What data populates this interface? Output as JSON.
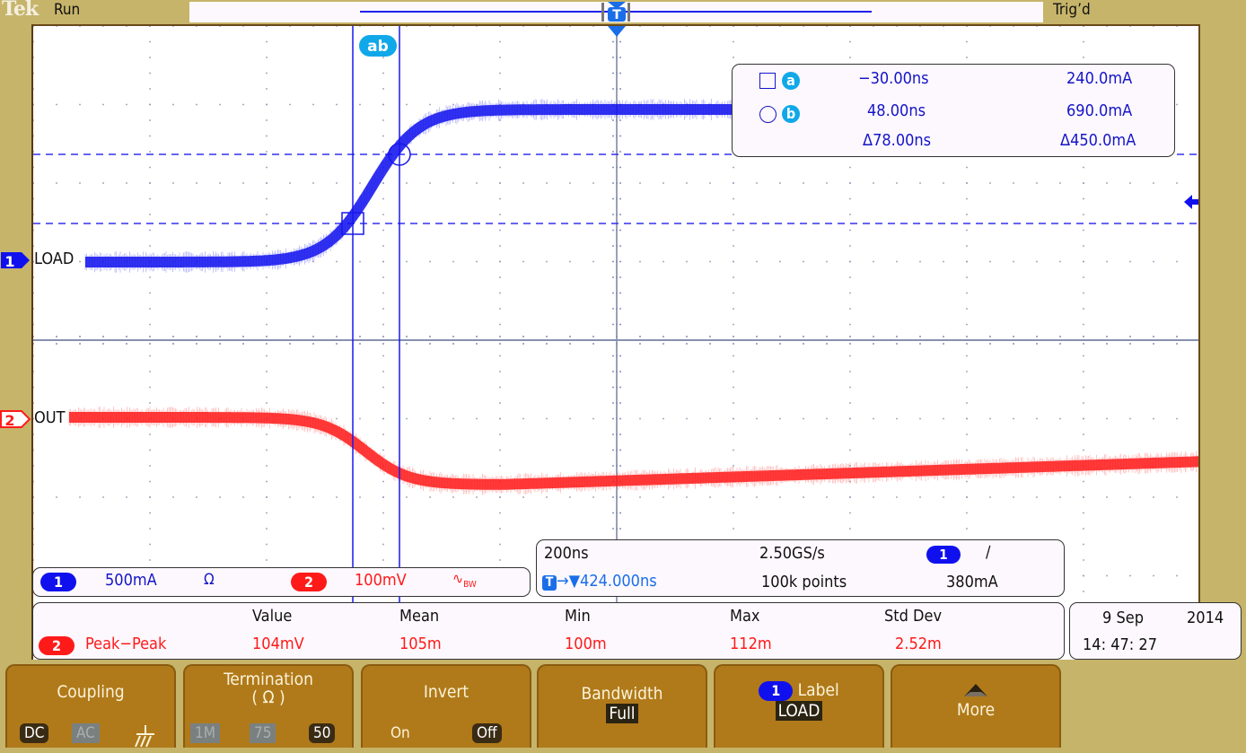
{
  "header": {
    "brand": "Tek",
    "acquisition_state": "Run",
    "trigger_state": "Trig’d"
  },
  "record_view": {
    "trigger_marker_label": "T"
  },
  "waveform_labels": {
    "ch1": {
      "number": "1",
      "label": "LOAD",
      "color": "#1010ee"
    },
    "ch2": {
      "number": "2",
      "label": "OUT",
      "color": "#ff1a1a"
    }
  },
  "cursors": {
    "pair_label": "ab",
    "cursor_a": {
      "symbol": "a",
      "time": "−30.00ns",
      "value": "240.0mA"
    },
    "cursor_b": {
      "symbol": "b",
      "time": "48.00ns",
      "value": "690.0mA"
    },
    "delta": {
      "time": "Δ78.00ns",
      "value": "Δ450.0mA"
    }
  },
  "vertical_readout": {
    "ch1": {
      "number": "1",
      "scale": "500mA",
      "icon": "ohm-icon",
      "icon_glyph": "Ω"
    },
    "ch2": {
      "number": "2",
      "scale": "100mV",
      "icon": "bandwidth-limit-icon",
      "icon_glyph": "∿",
      "bw_label": "BW"
    }
  },
  "horizontal_readout": {
    "time_per_div": "200ns",
    "sample_rate": "2.50GS/s",
    "trigger_source": "1",
    "trigger_slope_glyph": "∕",
    "trigger_position": "424.000ns",
    "trigger_position_prefix": "T",
    "record_length": "100k points",
    "trigger_level": "380mA"
  },
  "measurements": {
    "headers": [
      "Value",
      "Mean",
      "Min",
      "Max",
      "Std Dev"
    ],
    "rows": [
      {
        "channel": "2",
        "name": "Peak−Peak",
        "value": "104mV",
        "mean": "105m",
        "min": "100m",
        "max": "112m",
        "std_dev": "2.52m"
      }
    ]
  },
  "datetime": {
    "date_day_month": "9 Sep",
    "year": "2014",
    "time": "14: 47: 27"
  },
  "bottom_menu": {
    "coupling": {
      "title": "Coupling",
      "options": [
        "DC",
        "AC"
      ],
      "selected": "DC",
      "ground_icon": "ground-icon"
    },
    "termination": {
      "title": "Termination",
      "subtitle": "( Ω )",
      "options": [
        "1M",
        "75",
        "50"
      ],
      "selected": "50"
    },
    "invert": {
      "title": "Invert",
      "options": [
        "On",
        "Off"
      ],
      "selected": "Off"
    },
    "bandwidth": {
      "title": "Bandwidth",
      "value": "Full"
    },
    "label": {
      "channel": "1",
      "title": "Label",
      "value": "LOAD"
    },
    "more": {
      "title": "More"
    }
  },
  "colors": {
    "ch1": "#1010ee",
    "ch2": "#ff1a1a",
    "cursor_badge": "#10a8e8",
    "bezel": "#c6b46a",
    "menu_button": "#b07a1a"
  }
}
